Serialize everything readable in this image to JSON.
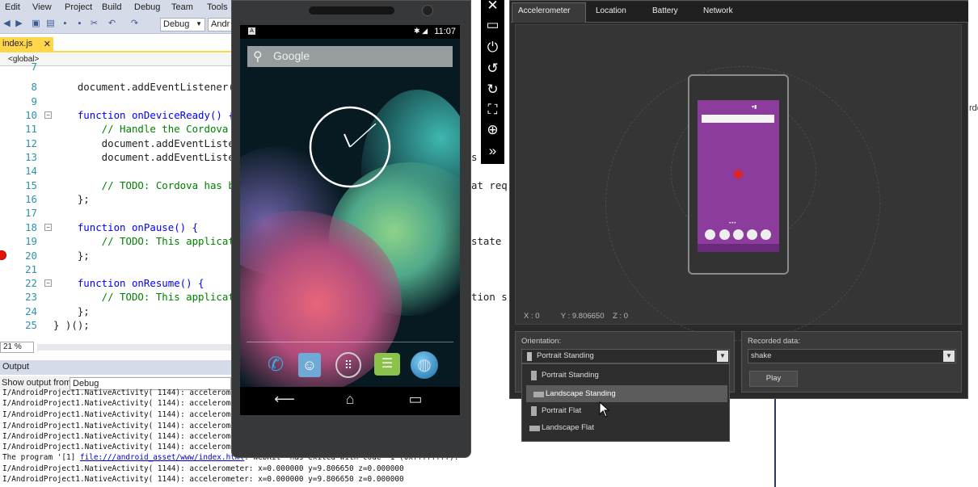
{
  "vs": {
    "menu": [
      "Edit",
      "View",
      "Project",
      "Build",
      "Debug",
      "Team",
      "Tools"
    ],
    "toolbar": {
      "config": "Debug",
      "platform": "Andr"
    },
    "tab": {
      "name": "index.js",
      "close": "✕"
    },
    "scope": "<global>",
    "code_lines": [
      {
        "n": "7",
        "text": ""
      },
      {
        "n": "8",
        "text": "    document.addEventListener("
      },
      {
        "n": "9",
        "text": ""
      },
      {
        "n": "10",
        "text": "    function onDeviceReady() {"
      },
      {
        "n": "11",
        "text": "        // Handle the Cordova"
      },
      {
        "n": "12",
        "text": "        document.addEventListe"
      },
      {
        "n": "13",
        "text": "        document.addEventListe"
      },
      {
        "n": "14",
        "text": ""
      },
      {
        "n": "15",
        "text": "        // TODO: Cordova has b"
      },
      {
        "n": "16",
        "text": "    };"
      },
      {
        "n": "17",
        "text": ""
      },
      {
        "n": "18",
        "text": "    function onPause() {"
      },
      {
        "n": "19",
        "text": "        // TODO: This applicat"
      },
      {
        "n": "20",
        "text": "    };"
      },
      {
        "n": "21",
        "text": ""
      },
      {
        "n": "22",
        "text": "    function onResume() {"
      },
      {
        "n": "23",
        "text": "        // TODO: This applicat"
      },
      {
        "n": "24",
        "text": "    };"
      },
      {
        "n": "25",
        "text": "} )();"
      }
    ],
    "overflow_text": [
      "s",
      "at req",
      "state",
      "tion s"
    ],
    "zoom": "21 %",
    "right_edge_text": "rde",
    "output_header": "Output",
    "show_output_label": "Show output from:",
    "show_output_value": "Debug",
    "output_lines": [
      "I/AndroidProject1.NativeActivity( 1144): acceleromet",
      "I/AndroidProject1.NativeActivity( 1144): acceleromet",
      "I/AndroidProject1.NativeActivity( 1144): acceleromet",
      "I/AndroidProject1.NativeActivity( 1144): acceleromet",
      "I/AndroidProject1.NativeActivity( 1144): acceleromet",
      "I/AndroidProject1.NativeActivity( 1144): acceleromet"
    ],
    "program_line_prefix": "The program '[1] ",
    "program_line_link": "file:///android_asset/www/index.html",
    "program_line_suffix": ": WebKit' has exited with code -1 (0xffffffff).",
    "accel_lines": [
      "I/AndroidProject1.NativeActivity( 1144): accelerometer: x=0.000000 y=9.806650 z=0.000000",
      "I/AndroidProject1.NativeActivity( 1144): accelerometer: x=0.000000 y=9.806650 z=0.000000"
    ]
  },
  "phone": {
    "status_time": "11:07",
    "status_a": "A",
    "status_icons": "✱ ◢",
    "search_placeholder": "Google",
    "dock": [
      "phone-app",
      "contacts-app",
      "app-drawer",
      "messaging-app",
      "browser-app"
    ],
    "nav": {
      "back": "⟵",
      "home": "⌂",
      "recents": "▭"
    }
  },
  "toolstrip": [
    "✕",
    "▭",
    "⏻",
    "↺",
    "↻",
    "⛶",
    "⊕",
    "»"
  ],
  "tools": {
    "tabs": [
      "Accelerometer",
      "Location",
      "Battery",
      "Network"
    ],
    "readout": {
      "x": "X : 0",
      "y": "Y : 9.806650",
      "z": "Z : 0"
    },
    "orientation_label": "Orientation:",
    "orientation_value": "Portrait Standing",
    "orientation_options": [
      "Portrait Standing",
      "Landscape Standing",
      "Portrait Flat",
      "Landscape Flat"
    ],
    "orientation_selected_index": 1,
    "recorded_label": "Recorded data:",
    "recorded_value": "shake",
    "play_label": "Play"
  },
  "colors": {
    "vs_chrome": "#d6dbe9",
    "tab_active": "#ffd64a",
    "keyword": "#0000ff",
    "comment": "#008000",
    "line_number": "#2b91af",
    "breakpoint": "#e51400",
    "mini_screen": "#8b3c9c",
    "mini_ball": "#e02424",
    "tools_bg": "#2a2a2a"
  }
}
